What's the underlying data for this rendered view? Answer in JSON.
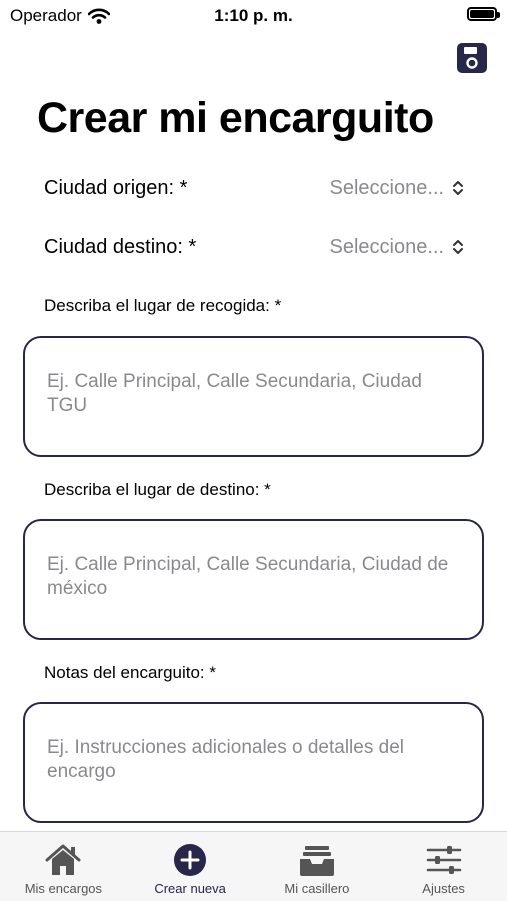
{
  "status_bar": {
    "carrier": "Operador",
    "time": "1:10 p. m."
  },
  "header": {
    "title": "Crear mi encarguito",
    "save_icon": "save-icon"
  },
  "form": {
    "origin": {
      "label": "Ciudad origen: *",
      "value": "Seleccione..."
    },
    "destination": {
      "label": "Ciudad destino: *",
      "value": "Seleccione..."
    },
    "pickup": {
      "label": "Describa el lugar de recogida: *",
      "placeholder": "Ej. Calle Principal, Calle Secundaria, Ciudad TGU"
    },
    "dropoff": {
      "label": "Describa el lugar de destino: *",
      "placeholder": "Ej. Calle Principal, Calle Secundaria, Ciudad de méxico"
    },
    "notes": {
      "label": "Notas del encarguito: *",
      "placeholder": "Ej. Instrucciones adicionales o detalles del encargo"
    }
  },
  "tab_bar": {
    "tabs": [
      {
        "label": "Mis encargos",
        "icon": "home-icon"
      },
      {
        "label": "Crear nueva",
        "icon": "plus-circle-icon",
        "active": true
      },
      {
        "label": "Mi casillero",
        "icon": "tray-icon"
      },
      {
        "label": "Ajustes",
        "icon": "sliders-icon"
      }
    ]
  },
  "colors": {
    "accent": "#27264b",
    "placeholder": "#8a8a8e",
    "tab_bar_bg": "#f6f6f6"
  }
}
